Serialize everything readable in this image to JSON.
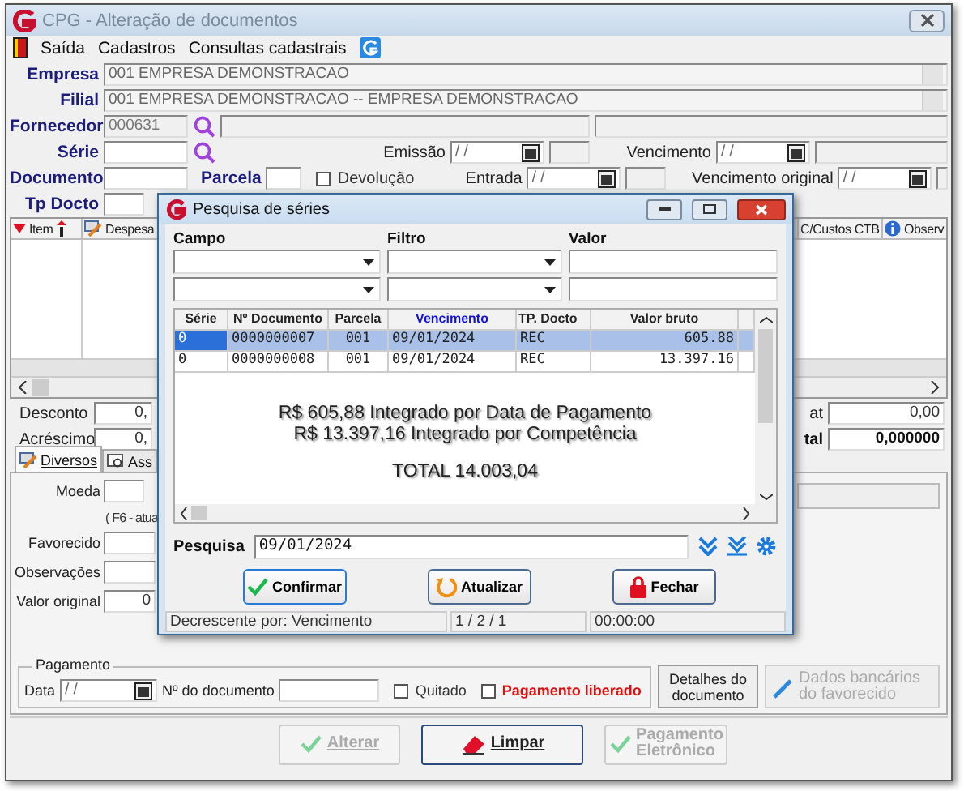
{
  "window": {
    "title": "CPG - Alteração de documentos"
  },
  "menu": [
    "Saída",
    "Cadastros",
    "Consultas cadastrais"
  ],
  "empresa": {
    "label": "Empresa",
    "value": "001 EMPRESA DEMONSTRACAO"
  },
  "filial": {
    "label": "Filial",
    "value": "001 EMPRESA DEMONSTRACAO -- EMPRESA DEMONSTRACAO"
  },
  "fornecedor": {
    "label": "Fornecedor",
    "value": "000631"
  },
  "serie": {
    "label": "Série"
  },
  "emissao": {
    "label": "Emissão",
    "value": "/ /"
  },
  "vencimento": {
    "label": "Vencimento",
    "value": "/ /"
  },
  "documento": {
    "label": "Documento"
  },
  "parcela": {
    "label": "Parcela"
  },
  "devolucao": {
    "label": "Devolução",
    "checked": false
  },
  "entrada": {
    "label": "Entrada",
    "value": "/ /"
  },
  "vencimento_original": {
    "label": "Vencimento original",
    "value": "/ /"
  },
  "tp_docto": {
    "label": "Tp Docto"
  },
  "items_grid": {
    "columns": [
      "Item",
      "Despesa",
      "C/Custos CTB",
      "Observ"
    ]
  },
  "left_totals": [
    {
      "label": "Desconto",
      "value": "0,"
    },
    {
      "label": "Acréscimo",
      "value": "0,"
    }
  ],
  "right_totals": [
    {
      "label": "at",
      "value": "0,00",
      "bold": false
    },
    {
      "label": "tal",
      "value": "0,000000",
      "bold": true
    }
  ],
  "tabs": [
    {
      "label": "Diversos",
      "selected": true
    },
    {
      "label": "Ass",
      "selected": false
    }
  ],
  "diversos": {
    "moeda": "Moeda",
    "hint": "( F6 - atua",
    "favorecido": "Favorecido",
    "observacoes": "Observações",
    "valor_original": {
      "label": "Valor original",
      "value": "0"
    }
  },
  "pagamento": {
    "title": "Pagamento",
    "data_label": "Data",
    "data_value": "/ /",
    "documento_label": "Nº do documento",
    "quitado": {
      "label": "Quitado",
      "checked": false
    },
    "liberado": {
      "label": "Pagamento liberado",
      "checked": false
    }
  },
  "side_buttons": [
    {
      "label": "Detalhes do documento",
      "disabled": false
    },
    {
      "label": "Dados bancários do favorecido",
      "disabled": true
    }
  ],
  "bottom_buttons": [
    {
      "label": "Alterar",
      "disabled": true
    },
    {
      "label": "Limpar",
      "disabled": false
    },
    {
      "label": "Pagamento Eletrônico",
      "disabled": true
    }
  ],
  "dialog": {
    "title": "Pesquisa de séries",
    "filter_labels": [
      "Campo",
      "Filtro",
      "Valor"
    ],
    "columns": [
      {
        "label": "Série",
        "sorted": false
      },
      {
        "label": "Nº Documento",
        "sorted": false
      },
      {
        "label": "Parcela",
        "sorted": false
      },
      {
        "label": "Vencimento",
        "sorted": true
      },
      {
        "label": "TP. Docto",
        "sorted": false
      },
      {
        "label": "Valor bruto",
        "sorted": false
      }
    ],
    "rows": [
      {
        "cells": [
          "0",
          "0000000007",
          "001",
          "09/01/2024",
          "REC",
          "605.88"
        ],
        "selected": true
      },
      {
        "cells": [
          "0",
          "0000000008",
          "001",
          "09/01/2024",
          "REC",
          "13.397.16"
        ],
        "selected": false
      }
    ],
    "message": [
      "R$ 605,88 Integrado por Data de Pagamento",
      "R$ 13.397,16 Integrado por Competência"
    ],
    "total": "TOTAL 14.003,04",
    "search": {
      "label": "Pesquisa",
      "value": "09/01/2024"
    },
    "buttons": [
      {
        "label": "Confirmar"
      },
      {
        "label": "Atualizar"
      },
      {
        "label": "Fechar"
      }
    ],
    "status": [
      "Decrescente por: Vencimento",
      "1 / 2 / 1",
      "00:00:00"
    ]
  }
}
